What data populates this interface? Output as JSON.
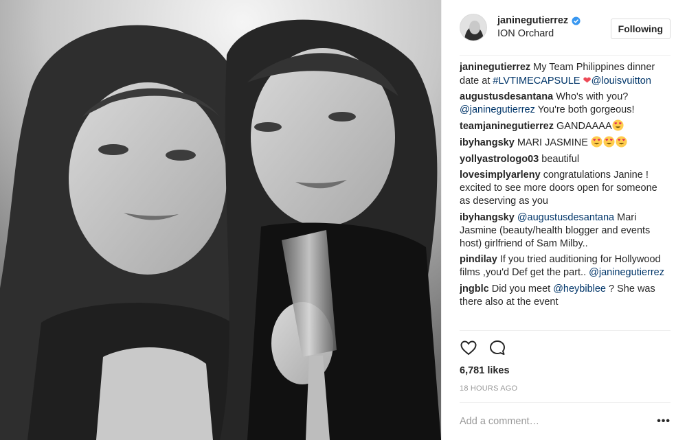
{
  "post": {
    "username": "janinegutierrez",
    "location": "ION Orchard",
    "follow_label": "Following"
  },
  "caption": {
    "user": "janinegutierrez",
    "text": "My Team Philippines dinner date at ",
    "hashtag": "#LVTIMECAPSULE",
    "heart": "❤",
    "mention": "@louisvuitton"
  },
  "comments": [
    {
      "user": "augustusdesantana",
      "text_before": "Who's with you?",
      "mention": "@janinegutierrez",
      "text_after": " You're both gorgeous!"
    },
    {
      "user": "teamjaninegutierrez",
      "text": "GANDAAAA"
    },
    {
      "user": "ibyhangsky",
      "text": "MARI JASMINE"
    },
    {
      "user": "yollyastrologo03",
      "text": "beautiful"
    },
    {
      "user": "lovesimplyarleny",
      "text": "congratulations Janine ! excited to see more doors open for someone as deserving as you"
    },
    {
      "user": "ibyhangsky",
      "mention": "@augustusdesantana",
      "text": " Mari Jasmine (beauty/health blogger and events host) girlfriend of Sam Milby.."
    },
    {
      "user": "pindilay",
      "text": "If you tried auditioning for Hollywood films ,you'd Def get the part..",
      "mention": "@janinegutierrez"
    },
    {
      "user": "jngblc",
      "text_before": "Did you meet ",
      "mention": "@heybiblee",
      "text_after": " ? She was there also at the event"
    }
  ],
  "icons": {
    "verified": "verified-badge-icon",
    "like": "heart-outline-icon",
    "comment": "speech-bubble-icon",
    "more": "ellipsis-icon",
    "emoji": "heart-eyes-emoji"
  },
  "stats": {
    "likes": "6,781 likes",
    "time": "18 HOURS AGO"
  },
  "add_comment": {
    "placeholder": "Add a comment…",
    "more": "•••"
  },
  "colors": {
    "verified": "#3897f0",
    "link": "#003569",
    "heart": "#ed4956",
    "muted": "#999999"
  }
}
